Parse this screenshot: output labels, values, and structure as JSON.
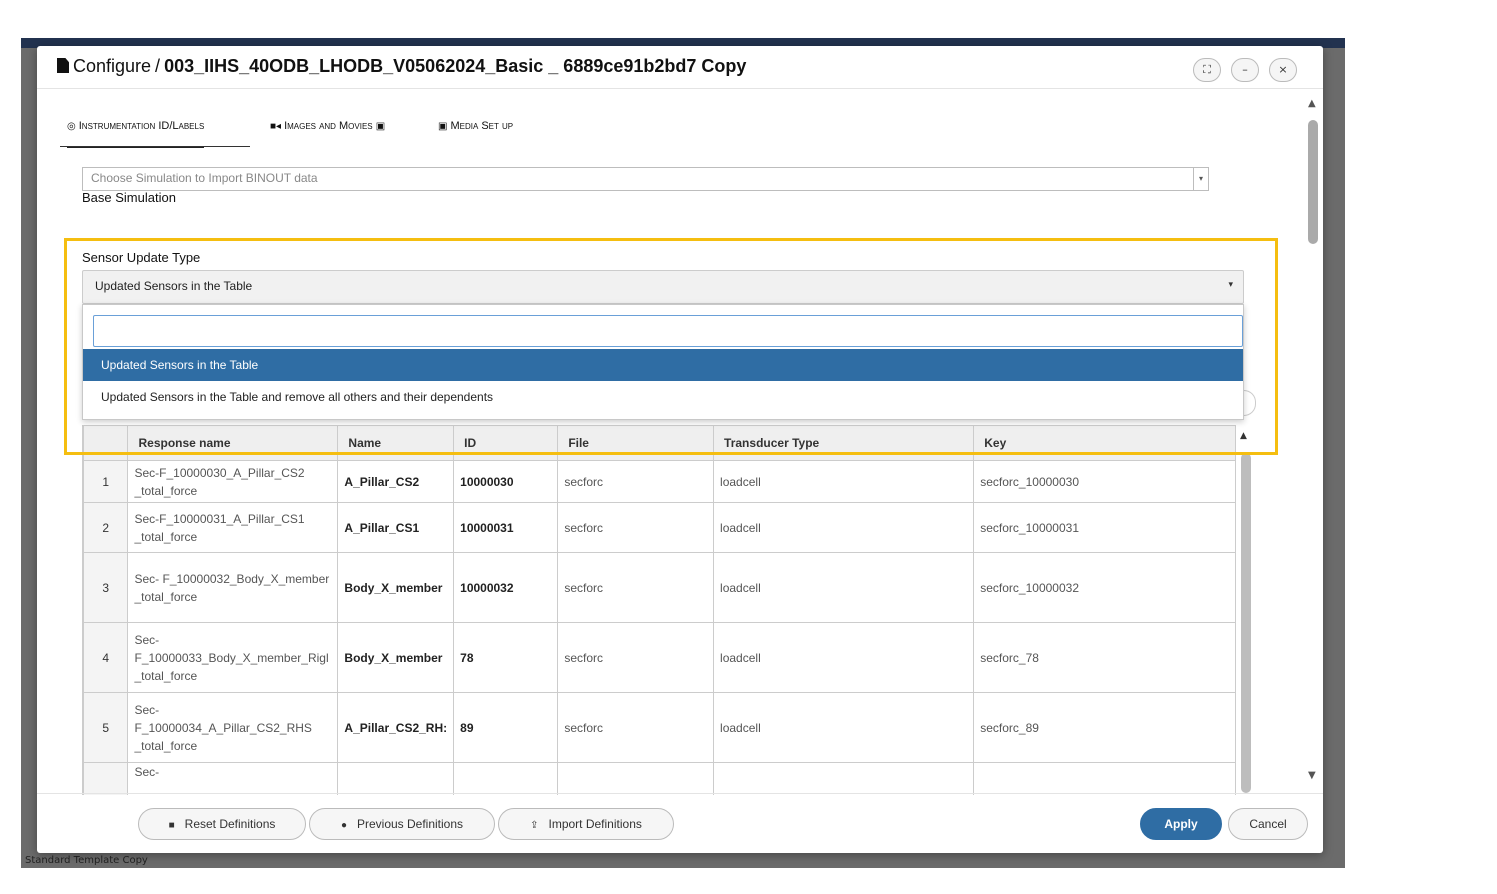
{
  "dialog": {
    "title_prefix": "Configure",
    "title_separator": "/",
    "title_name": "003_IIHS_40ODB_LHODB_V05062024_Basic _ 6889ce91b2bd7 Copy"
  },
  "window_controls": {
    "expand": "⛶",
    "minimize": "–",
    "close": "×"
  },
  "tabs": [
    {
      "icon": "◎",
      "label": "Instrumentation ID/Labels",
      "active": true
    },
    {
      "icon": "■◂",
      "label": "Images and Movies",
      "icon_after": "▣",
      "active": false
    },
    {
      "icon": "▣",
      "label": "Media Set up",
      "active": false
    }
  ],
  "base_simulation": {
    "label": "Base Simulation",
    "placeholder": "Choose Simulation to Import BINOUT data"
  },
  "sensor_update": {
    "label": "Sensor Update Type",
    "selected": "Updated Sensors in the Table",
    "options": [
      "Updated Sensors in the Table",
      "Updated Sensors in the Table and remove all others and their dependents"
    ]
  },
  "table": {
    "columns": [
      "",
      "Response name",
      "Name",
      "ID",
      "File",
      "Transducer Type",
      "Key"
    ],
    "rows": [
      {
        "num": "1",
        "response": "Sec-F_10000030_A_Pillar_CS2 _total_force",
        "name": "A_Pillar_CS2",
        "id": "10000030",
        "file": "secforc",
        "type": "loadcell",
        "key": "secforc_10000030"
      },
      {
        "num": "2",
        "response": "Sec-F_10000031_A_Pillar_CS1 _total_force",
        "name": "A_Pillar_CS1",
        "id": "10000031",
        "file": "secforc",
        "type": "loadcell",
        "key": "secforc_10000031"
      },
      {
        "num": "3",
        "response": "Sec- F_10000032_Body_X_member _total_force",
        "name": "Body_X_member",
        "id": "10000032",
        "file": "secforc",
        "type": "loadcell",
        "key": "secforc_10000032"
      },
      {
        "num": "4",
        "response": "Sec- F_10000033_Body_X_member_Rigl _total_force",
        "name": "Body_X_member",
        "id": "78",
        "file": "secforc",
        "type": "loadcell",
        "key": "secforc_78"
      },
      {
        "num": "5",
        "response": "Sec- F_10000034_A_Pillar_CS2_RHS _total_force",
        "name": "A_Pillar_CS2_RH:",
        "id": "89",
        "file": "secforc",
        "type": "loadcell",
        "key": "secforc_89"
      },
      {
        "num": "",
        "response": "Sec-",
        "name": "",
        "id": "",
        "file": "",
        "type": "",
        "key": ""
      }
    ]
  },
  "footer": {
    "reset": "Reset Definitions",
    "previous": "Previous Definitions",
    "import": "Import Definitions",
    "apply": "Apply",
    "cancel": "Cancel"
  },
  "background": {
    "footer_text": "Standard Template Copy"
  },
  "colors": {
    "primary": "#2f6da4",
    "highlight": "#f5be10"
  }
}
